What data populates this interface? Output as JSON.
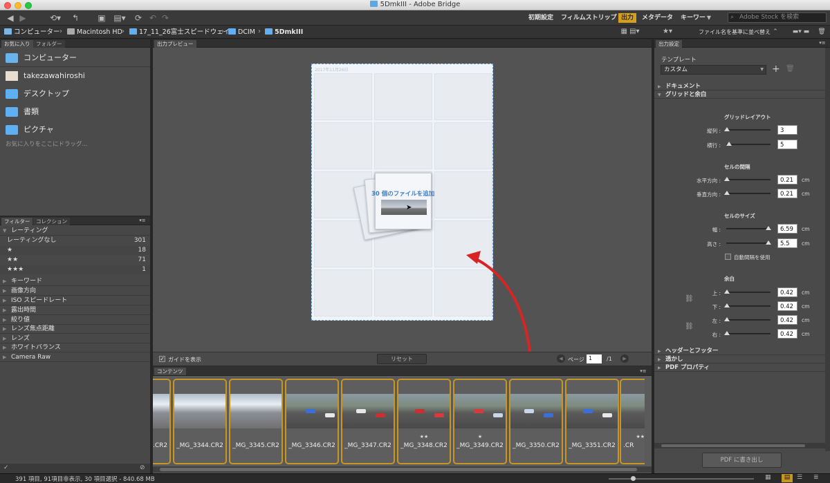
{
  "window": {
    "title": "5DmkIII - Adobe Bridge"
  },
  "workspaces": [
    {
      "label": "初期設定",
      "active": false
    },
    {
      "label": "フィルムストリップ",
      "active": false
    },
    {
      "label": "出力",
      "active": true
    },
    {
      "label": "メタデータ",
      "active": false
    },
    {
      "label": "キーワー",
      "active": false
    }
  ],
  "search": {
    "placeholder": "Adobe Stock を検索"
  },
  "path": {
    "items": [
      "コンピューター",
      "Macintosh HD",
      "17_11_26富士スピードウェイ",
      "DCIM",
      "5DmkIII"
    ],
    "sort_label": "ファイル名を基準に並べ替え"
  },
  "left": {
    "tabs": [
      "お気に入り",
      "フォルダー"
    ],
    "favorites": [
      "コンピューター",
      "takezawahiroshi",
      "デスクトップ",
      "書類",
      "ピクチャ"
    ],
    "drag_hint": "お気に入りをここにドラッグ...",
    "filter_tabs": [
      "フィルター",
      "コレクション"
    ],
    "rating_header": "レーティング",
    "ratings": [
      {
        "label": "レーティングなし",
        "count": "301"
      },
      {
        "label": "★",
        "count": "18"
      },
      {
        "label": "★★",
        "count": "71"
      },
      {
        "label": "★★★",
        "count": "1"
      }
    ],
    "filters": [
      "キーワード",
      "画像方向",
      "ISO スピードレート",
      "露出時間",
      "絞り値",
      "レンズ焦点距離",
      "レンズ",
      "ホワイトバランス",
      "Camera Raw"
    ]
  },
  "preview": {
    "tab": "出力プレビュー",
    "page_header": "2017年11月26日",
    "drop_text": "30 個のファイルを追加",
    "show_guides": "ガイドを表示",
    "reset": "リセット",
    "page_label": "ページ",
    "page_value": "1",
    "page_total": "/1"
  },
  "content": {
    "tab": "コンテンツ",
    "thumbs": [
      {
        "name": "_MG_3344.CR2",
        "stars": "",
        "style": "mt"
      },
      {
        "name": "_MG_3345.CR2",
        "stars": "",
        "style": "mt"
      },
      {
        "name": "_MG_3346.CR2",
        "stars": "",
        "style": "track"
      },
      {
        "name": "_MG_3347.CR2",
        "stars": "",
        "style": "track"
      },
      {
        "name": "_MG_3348.CR2",
        "stars": "★★",
        "style": "track"
      },
      {
        "name": "_MG_3349.CR2",
        "stars": "★",
        "style": "track"
      },
      {
        "name": "_MG_3350.CR2",
        "stars": "",
        "style": "track"
      },
      {
        "name": "_MG_3351.CR2",
        "stars": "",
        "style": "track"
      }
    ],
    "partial_left_name": ".CR2",
    "partial_right_name": ".CR",
    "partial_right_stars": "★★"
  },
  "right": {
    "tab": "出力設定",
    "template_label": "テンプレート",
    "template_value": "カスタム",
    "sections": [
      "ドキュメント",
      "グリッドと余白"
    ],
    "grid_layout": "グリッドレイアウト",
    "rows_label": "縦列 :",
    "rows": "3",
    "cols_label": "横行 :",
    "cols": "5",
    "cell_spacing": "セルの間隔",
    "h_label": "水平方向 :",
    "h": "0.21",
    "v_label": "垂直方向 :",
    "v": "0.21",
    "cell_size": "セルのサイズ",
    "w_label": "幅 :",
    "w": "6.59",
    "ht_label": "高さ :",
    "ht": "5.5",
    "auto_spacing": "自動間隔を使用",
    "margin": "余白",
    "top_label": "上 :",
    "top": "0.42",
    "bottom_label": "下 :",
    "bottom": "0.42",
    "left_label": "左 :",
    "left": "0.42",
    "right_label": "右 :",
    "right": "0.42",
    "unit": "cm",
    "bottom_sections": [
      "ヘッダーとフッター",
      "透かし",
      "PDF プロパティ"
    ],
    "export": "PDF に書き出し"
  },
  "status": {
    "text": "391 項目, 91項目非表示, 30 項目選択 - 840.68 MB"
  }
}
